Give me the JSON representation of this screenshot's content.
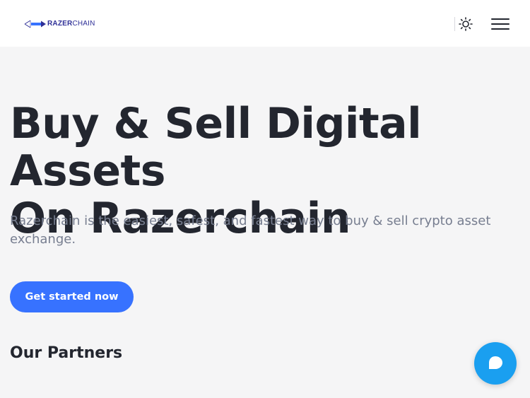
{
  "header": {
    "logo": {
      "bold_text": "RAZER",
      "light_text": "CHAIN",
      "icon": "arrow-logo-icon"
    },
    "theme_toggle_icon": "sun-icon",
    "menu_icon": "hamburger-menu-icon"
  },
  "hero": {
    "title_line1": "Buy & Sell Digital Assets",
    "title_line2": "On Razerchain",
    "subtitle": "Razerchain is the easiest, safest, and fastest way to buy & sell crypto asset exchange.",
    "cta_label": "Get started now"
  },
  "partners": {
    "heading": "Our Partners"
  },
  "chat": {
    "icon": "chat-bubble-icon"
  },
  "colors": {
    "accent": "#3772ff",
    "chat": "#1a9ff0",
    "heading": "#23262f",
    "muted": "#777e90",
    "background": "#f5f5f6",
    "logo": "#2e2f97"
  }
}
